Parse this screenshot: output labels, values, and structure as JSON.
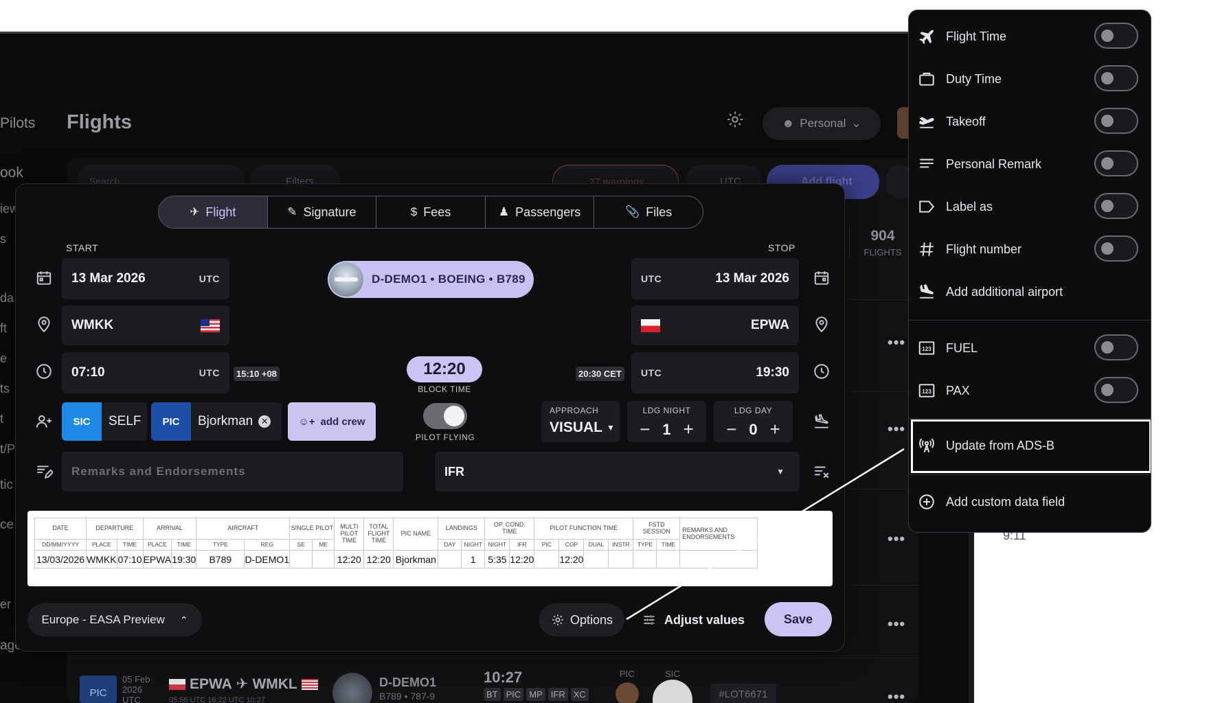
{
  "background": {
    "sidebar_fragments": [
      "Pilots",
      "ook",
      "iew",
      "s",
      "da",
      "ft",
      "e",
      "ts",
      "t",
      "t/P",
      "tic",
      "ce",
      "er",
      "age"
    ],
    "page_title": "Flights",
    "header_personal": "Personal",
    "search_placeholder": "Search",
    "filters_label": "Filters",
    "warnings_label": "27 warnings",
    "utc_label": "UTC",
    "add_flight_label": "Add flight",
    "flights_count": "904",
    "flights_count_label": "FLIGHTS",
    "count_suffix": "R",
    "bottom_row": {
      "role": "PIC",
      "date_line1": "05 Feb",
      "date_line2": "2026",
      "date_line3": "UTC",
      "route_from": "EPWA",
      "route_to": "WMKL",
      "route_times": "05:55 UTC 16:22 UTC  10:27",
      "aircraft_reg": "D-DEMO1",
      "aircraft_type": "B789 • 787-9",
      "duration": "10:27",
      "tags": [
        "BT",
        "PIC",
        "MP",
        "IFR",
        "XC"
      ],
      "pic_label": "PIC",
      "sic_label": "SIC",
      "lot_label": "#LOT6671",
      "peek_time": "9:11"
    }
  },
  "modal": {
    "tabs": [
      {
        "label": "Flight",
        "icon": "plane-icon"
      },
      {
        "label": "Signature",
        "icon": "signature-icon"
      },
      {
        "label": "Fees",
        "icon": "dollar-icon"
      },
      {
        "label": "Passengers",
        "icon": "passenger-icon"
      },
      {
        "label": "Files",
        "icon": "paperclip-icon"
      }
    ],
    "start_label": "START",
    "stop_label": "STOP",
    "start_date": "13 Mar 2026",
    "start_date_tz": "UTC",
    "stop_date": "13 Mar 2026",
    "stop_date_tz": "UTC",
    "aircraft": "D-DEMO1 • BOEING • B789",
    "dep_airport": "WMKK",
    "arr_airport": "EPWA",
    "dep_time": "07:10",
    "dep_time_tz": "UTC",
    "dep_local": "15:10 +08",
    "arr_time": "19:30",
    "arr_time_tz": "UTC",
    "arr_local": "20:30 CET",
    "block_time": "12:20",
    "block_time_label": "BLOCK TIME",
    "crew": [
      {
        "role": "SIC",
        "name": "SELF",
        "color": "#1e88e5"
      },
      {
        "role": "PIC",
        "name": "Bjorkman",
        "color": "#1b4fa8"
      }
    ],
    "add_crew_label": "add crew",
    "pilot_flying_label": "PILOT FLYING",
    "approach_label": "APPROACH",
    "approach_value": "VISUAL",
    "ldg_night_label": "LDG NIGHT",
    "ldg_night_value": "1",
    "ldg_day_label": "LDG DAY",
    "ldg_day_value": "0",
    "remarks_placeholder": "Remarks and Endorsements",
    "flight_rules": "IFR",
    "region_label": "Europe - EASA Preview",
    "options_label": "Options",
    "adjust_label": "Adjust values",
    "save_label": "Save"
  },
  "logbook_table": {
    "headers": [
      "DATE",
      "DEPARTURE",
      "ARRIVAL",
      "AIRCRAFT",
      "SINGLE PILOT",
      "MULTI PILOT TIME",
      "TOTAL FLIGHT TIME",
      "PIC NAME",
      "LANDINGS",
      "OP. COND. TIME",
      "PILOT FUNCTION TIME",
      "FSTD SESSION",
      "REMARKS AND ENDORSEMENTS"
    ],
    "subheaders": [
      "DD/MM/YYYY",
      "PLACE",
      "TIME",
      "PLACE",
      "TIME",
      "TYPE",
      "REG",
      "SE",
      "ME",
      "DAY",
      "NIGHT",
      "NIGHT",
      "IFR",
      "PIC",
      "COP",
      "DUAL",
      "INSTR",
      "TYPE",
      "TIME"
    ],
    "row": {
      "date": "13/03/2026",
      "dep_place": "WMKK",
      "dep_time": "07:10",
      "arr_place": "EPWA",
      "arr_time": "19:30",
      "type": "B789",
      "reg": "D-DEMO1",
      "se": "",
      "me": "",
      "multi_pilot": "12:20",
      "total": "12:20",
      "pic_name": "Bjorkman",
      "ldg_day": "",
      "ldg_night": "1",
      "night": "5:35",
      "ifr": "12:20",
      "fn_pic": "",
      "fn_cop": "12:20",
      "fn_dual": "",
      "fn_instr": "",
      "fstd_type": "",
      "fstd_time": "",
      "remarks": ""
    }
  },
  "options_menu": {
    "items": [
      {
        "label": "Flight Time",
        "icon": "airplane-icon",
        "toggle": false
      },
      {
        "label": "Duty Time",
        "icon": "briefcase-icon",
        "toggle": false
      },
      {
        "label": "Takeoff",
        "icon": "takeoff-icon",
        "toggle": false
      },
      {
        "label": "Personal Remark",
        "icon": "lines-icon",
        "toggle": false
      },
      {
        "label": "Label as",
        "icon": "label-icon",
        "toggle": false
      },
      {
        "label": "Flight number",
        "icon": "hash-icon",
        "toggle": false
      },
      {
        "label": "Add additional airport",
        "icon": "landing-icon"
      },
      {
        "label": "FUEL",
        "icon": "numeric-field-icon",
        "toggle": false
      },
      {
        "label": "PAX",
        "icon": "numeric-field-icon",
        "toggle": false
      },
      {
        "label": "Update from ADS-B",
        "icon": "broadcast-icon"
      },
      {
        "label": "Add custom data field",
        "icon": "plus-circle-icon"
      }
    ]
  }
}
